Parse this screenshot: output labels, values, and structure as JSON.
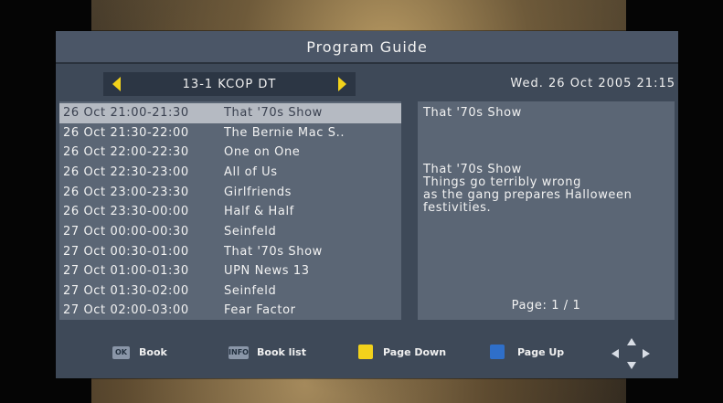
{
  "title": "Program Guide",
  "channel": {
    "name": "13-1 KCOP DT",
    "prev_icon": "triangle-left-icon",
    "next_icon": "triangle-right-icon"
  },
  "datetime": "Wed.  26 Oct 2005 21:15",
  "programs": [
    {
      "time": "26 Oct 21:00-21:30",
      "title": "That '70s Show"
    },
    {
      "time": "26 Oct 21:30-22:00",
      "title": "The Bernie Mac S.."
    },
    {
      "time": "26 Oct 22:00-22:30",
      "title": "One on One"
    },
    {
      "time": "26 Oct 22:30-23:00",
      "title": "All of Us"
    },
    {
      "time": "26 Oct 23:00-23:30",
      "title": "Girlfriends"
    },
    {
      "time": "26 Oct 23:30-00:00",
      "title": "Half & Half"
    },
    {
      "time": "27 Oct 00:00-00:30",
      "title": "Seinfeld"
    },
    {
      "time": "27 Oct 00:30-01:00",
      "title": "That '70s Show"
    },
    {
      "time": "27 Oct 01:00-01:30",
      "title": "UPN News 13"
    },
    {
      "time": "27 Oct 01:30-02:00",
      "title": "Seinfeld"
    },
    {
      "time": "27 Oct 02:00-03:00",
      "title": "Fear Factor"
    }
  ],
  "selected_index": 0,
  "detail": {
    "title": "That '70s Show",
    "description": "That '70s Show\nThings go terribly wrong\nas the gang prepares Halloween\nfestivities.",
    "page": "Page:  1 /  1"
  },
  "footer": {
    "ok_key": "OK",
    "ok_label": "Book",
    "info_key": "INFO",
    "info_label": "Book list",
    "yellow_label": "Page Down",
    "blue_label": "Page Up",
    "yellow_color": "#f2d21b",
    "blue_color": "#2f6fc9",
    "nav_icon": "dpad-arrows-icon"
  }
}
